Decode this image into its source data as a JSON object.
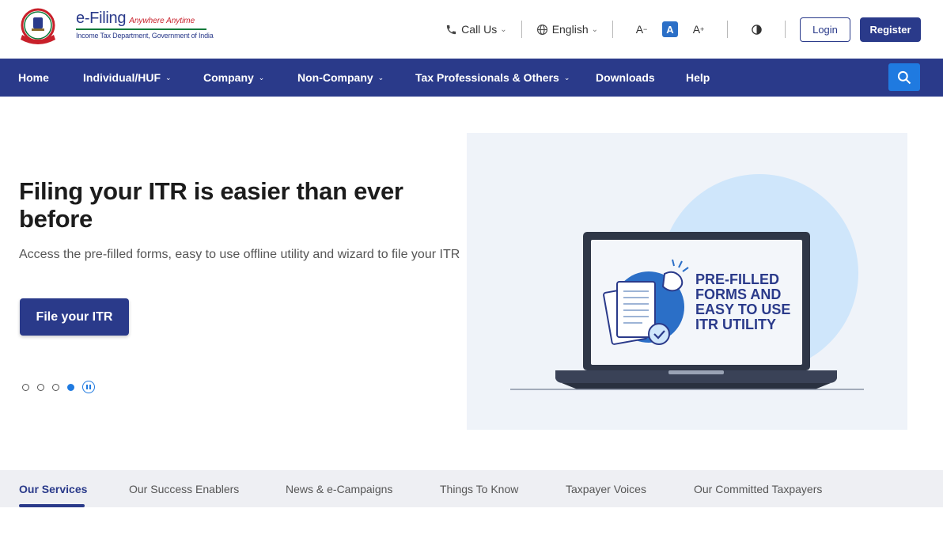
{
  "header": {
    "brand": "e-Filing",
    "tagline": "Anywhere Anytime",
    "department": "Income Tax Department, Government of India",
    "call_us": "Call Us",
    "language": "English",
    "font_decrease": "A",
    "font_default": "A",
    "font_increase": "A",
    "login": "Login",
    "register": "Register"
  },
  "nav": {
    "items": [
      {
        "label": "Home",
        "dropdown": false
      },
      {
        "label": "Individual/HUF",
        "dropdown": true
      },
      {
        "label": "Company",
        "dropdown": true
      },
      {
        "label": "Non-Company",
        "dropdown": true
      },
      {
        "label": "Tax Professionals & Others",
        "dropdown": true
      },
      {
        "label": "Downloads",
        "dropdown": false
      },
      {
        "label": "Help",
        "dropdown": false
      }
    ]
  },
  "hero": {
    "title": "Filing your ITR is easier than ever before",
    "subtitle": "Access the pre-filled forms, easy to use offline utility and wizard to file your ITR",
    "cta": "File your ITR",
    "slides_total": 4,
    "slide_active": 4,
    "illustration_text": [
      "PRE-FILLED",
      "FORMS AND",
      "EASY TO USE",
      "ITR UTILITY"
    ]
  },
  "tabs": {
    "items": [
      "Our Services",
      "Our Success Enablers",
      "News & e-Campaigns",
      "Things To Know",
      "Taxpayer Voices",
      "Our Committed Taxpayers"
    ],
    "active": "Our Services"
  },
  "colors": {
    "primary": "#2a3a8a",
    "accent": "#1f7ae0",
    "illustration_bg": "#eff3f9"
  }
}
